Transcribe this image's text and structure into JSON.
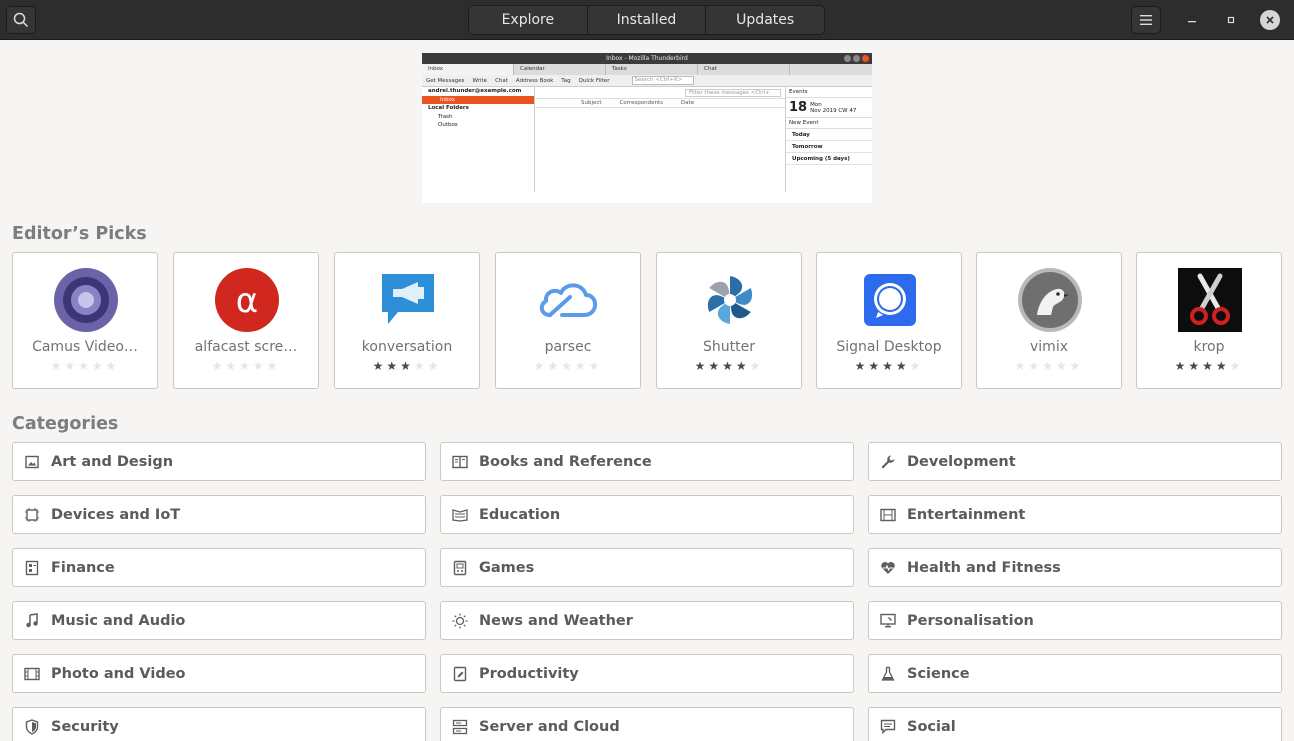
{
  "header": {
    "tabs": [
      {
        "label": "Explore"
      },
      {
        "label": "Installed"
      },
      {
        "label": "Updates"
      }
    ],
    "icons": [
      "search-icon",
      "menu-icon",
      "minimize-icon",
      "maximize-icon",
      "close-icon"
    ]
  },
  "banner": {
    "window_title": "Inbox - Mozilla Thunderbird",
    "tabs": [
      "Inbox",
      "Calendar",
      "Tasks",
      "Chat"
    ],
    "toolbar": [
      "Get Messages",
      "Write",
      "Chat",
      "Address Book",
      "Tag",
      "Quick Filter"
    ],
    "search_placeholder": "Search <Ctrl+K>",
    "folders": [
      {
        "label": "andrei.thunder@example.com",
        "style": "bold"
      },
      {
        "label": "Inbox",
        "style": "sel"
      },
      {
        "label": "Local Folders",
        "style": "bold"
      },
      {
        "label": "Trash",
        "style": "sub"
      },
      {
        "label": "Outbox",
        "style": "sub"
      }
    ],
    "filter_placeholder": "Filter these messages <Ctrl+",
    "columns": [
      "Subject",
      "Correspondents",
      "Date"
    ],
    "events_title": "Events",
    "day_number": "18",
    "day_name": "Mon",
    "month_week": "Nov 2019  CW 47",
    "new_event": "New Event",
    "event_rows": [
      "Today",
      "Tomorrow",
      "Upcoming (5 days)"
    ]
  },
  "editors_picks": {
    "title": "Editor’s Picks",
    "apps": [
      {
        "name": "Camus Video…",
        "rating": 0,
        "icon": "camus-icon"
      },
      {
        "name": "alfacast scre…",
        "rating": 0,
        "icon": "alfacast-icon"
      },
      {
        "name": "konversation",
        "rating": 3,
        "icon": "konversation-icon"
      },
      {
        "name": "parsec",
        "rating": 0,
        "icon": "parsec-icon"
      },
      {
        "name": "Shutter",
        "rating": 4,
        "icon": "shutter-icon"
      },
      {
        "name": "Signal Desktop",
        "rating": 4,
        "icon": "signal-icon"
      },
      {
        "name": "vimix",
        "rating": 0,
        "icon": "vimix-icon"
      },
      {
        "name": "krop",
        "rating": 4,
        "icon": "krop-icon"
      }
    ]
  },
  "categories": {
    "title": "Categories",
    "items": [
      {
        "label": "Art and Design",
        "icon": "image-icon"
      },
      {
        "label": "Books and Reference",
        "icon": "book-icon"
      },
      {
        "label": "Development",
        "icon": "wrench-icon"
      },
      {
        "label": "Devices and IoT",
        "icon": "device-icon"
      },
      {
        "label": "Education",
        "icon": "education-icon"
      },
      {
        "label": "Entertainment",
        "icon": "film-icon"
      },
      {
        "label": "Finance",
        "icon": "finance-icon"
      },
      {
        "label": "Games",
        "icon": "gamepad-icon"
      },
      {
        "label": "Health and Fitness",
        "icon": "heartbeat-icon"
      },
      {
        "label": "Music and Audio",
        "icon": "music-note-icon"
      },
      {
        "label": "News and Weather",
        "icon": "sun-icon"
      },
      {
        "label": "Personalisation",
        "icon": "monitor-icon"
      },
      {
        "label": "Photo and Video",
        "icon": "film-strip-icon"
      },
      {
        "label": "Productivity",
        "icon": "pencil-icon"
      },
      {
        "label": "Science",
        "icon": "flask-icon"
      },
      {
        "label": "Security",
        "icon": "shield-icon"
      },
      {
        "label": "Server and Cloud",
        "icon": "server-icon"
      },
      {
        "label": "Social",
        "icon": "chat-icon"
      }
    ]
  },
  "colors": {
    "header_bg": "#2d2d2d",
    "page_bg": "#f6f5f4",
    "accent": "#e95420"
  }
}
